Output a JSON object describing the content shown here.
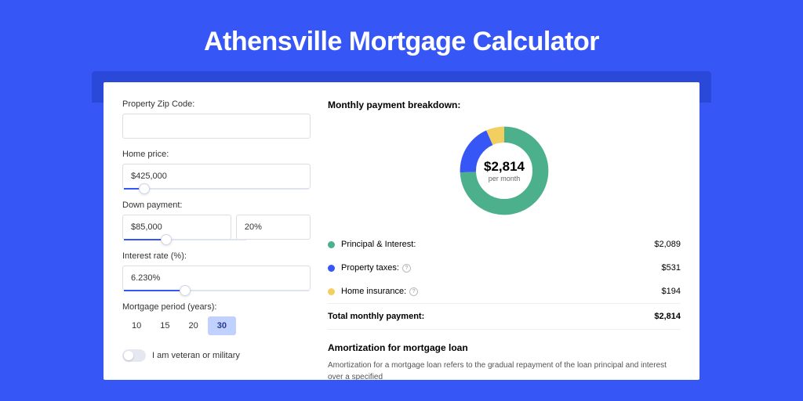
{
  "title": "Athensville Mortgage Calculator",
  "form": {
    "zip_label": "Property Zip Code:",
    "zip_value": "",
    "home_price_label": "Home price:",
    "home_price_value": "$425,000",
    "home_price_slider_pct": 8,
    "down_payment_label": "Down payment:",
    "down_payment_value": "$85,000",
    "down_payment_pct": "20%",
    "down_payment_slider_pct": 20,
    "interest_label": "Interest rate (%):",
    "interest_value": "6.230%",
    "interest_slider_pct": 30,
    "period_label": "Mortgage period (years):",
    "periods": [
      "10",
      "15",
      "20",
      "30"
    ],
    "period_active": "30",
    "veteran_label": "I am veteran or military"
  },
  "breakdown": {
    "title": "Monthly payment breakdown:",
    "center_value": "$2,814",
    "center_label": "per month",
    "items": [
      {
        "color": "green",
        "label": "Principal & Interest:",
        "value": "$2,089",
        "info": false
      },
      {
        "color": "blue",
        "label": "Property taxes:",
        "value": "$531",
        "info": true
      },
      {
        "color": "yellow",
        "label": "Home insurance:",
        "value": "$194",
        "info": true
      }
    ],
    "total_label": "Total monthly payment:",
    "total_value": "$2,814"
  },
  "chart_data": {
    "type": "pie",
    "title": "Monthly payment breakdown",
    "series": [
      {
        "name": "Principal & Interest",
        "value": 2089,
        "color": "#4cb08c"
      },
      {
        "name": "Property taxes",
        "value": 531,
        "color": "#3656f5"
      },
      {
        "name": "Home insurance",
        "value": 194,
        "color": "#f3cf61"
      }
    ],
    "total": 2814
  },
  "amortization": {
    "title": "Amortization for mortgage loan",
    "text": "Amortization for a mortgage loan refers to the gradual repayment of the loan principal and interest over a specified"
  }
}
